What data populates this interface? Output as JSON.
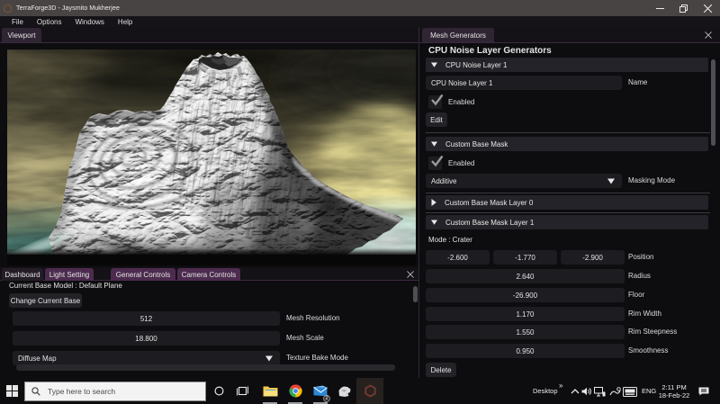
{
  "window": {
    "title": "TerraForge3D - Jaysmito Mukherjee",
    "controls": [
      "minimize",
      "maximize",
      "close"
    ]
  },
  "menu": {
    "items": [
      "File",
      "Options",
      "Windows",
      "Help"
    ]
  },
  "viewport_panel": {
    "tab": "Viewport"
  },
  "dashboard_panel": {
    "tabs": [
      "Dashboard",
      "Light Setting",
      "General Controls",
      "Camera Controls"
    ],
    "current_base_model": "Current Base Model : Default Plane",
    "change_base_button": "Change Current Base",
    "fields": [
      {
        "value": "512",
        "label": "Mesh Resolution"
      },
      {
        "value": "18.800",
        "label": "Mesh Scale"
      }
    ],
    "combo": {
      "value": "Diffuse Map",
      "label": "Texture Bake Mode"
    }
  },
  "mesh_panel": {
    "tab": "Mesh Generators",
    "heading": "CPU Noise Layer Generators",
    "layer1": {
      "header": "CPU Noise Layer 1",
      "name_value": "CPU Noise Layer 1",
      "name_label": "Name",
      "enabled_label": "Enabled",
      "edit_button": "Edit"
    },
    "mask": {
      "header": "Custom Base Mask",
      "enabled_label": "Enabled",
      "combo_value": "Additive",
      "combo_label": "Masking Mode"
    },
    "mask_layer0": {
      "header": "Custom Base Mask Layer 0"
    },
    "mask_layer1": {
      "header": "Custom Base Mask Layer 1",
      "mode": "Mode : Crater",
      "position": {
        "values": [
          "-2.600",
          "-1.770",
          "-2.900"
        ],
        "label": "Position"
      },
      "params": [
        {
          "value": "2.640",
          "label": "Radius"
        },
        {
          "value": "-26.900",
          "label": "Floor"
        },
        {
          "value": "1.170",
          "label": "Rim Width"
        },
        {
          "value": "1.550",
          "label": "Rim Steepness"
        },
        {
          "value": "0.950",
          "label": "Smoothness"
        }
      ],
      "delete_button": "Delete"
    }
  },
  "taskbar": {
    "search_placeholder": "Type here to search",
    "desktop_label": "Desktop",
    "overflow_chevron": "»",
    "mail_badge": "2",
    "tray": {
      "language": "ENG",
      "time": "2:11 PM",
      "date": "18-Feb-22"
    }
  },
  "colors": {
    "accent_purple": "#4c2b4e",
    "titlebar": "#474443",
    "panel_bg": "#0d0c0f"
  }
}
